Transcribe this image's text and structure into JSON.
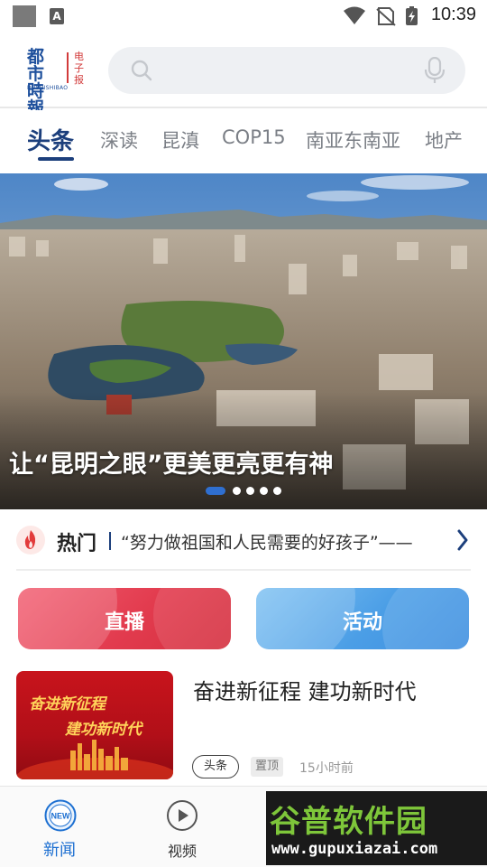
{
  "status_bar": {
    "a_badge": "A",
    "time": "10:39"
  },
  "header": {
    "logo": {
      "main": "都市時報",
      "sub": "DUSHISHIBAO",
      "side": "电子报"
    },
    "search_placeholder": ""
  },
  "tabs": [
    {
      "label": "头条",
      "active": true
    },
    {
      "label": "深读"
    },
    {
      "label": "昆滇"
    },
    {
      "label": "COP15"
    },
    {
      "label": "南亚东南亚"
    },
    {
      "label": "地产"
    }
  ],
  "hero": {
    "caption": "让“昆明之眼”更美更亮更有神",
    "slide_count": 5,
    "active_slide": 1
  },
  "hot": {
    "label": "热门",
    "text": "“努力做祖国和人民需要的好孩子”——"
  },
  "actions": {
    "live": "直播",
    "activity": "活动"
  },
  "news": [
    {
      "thumb_line1": "奋进新征程",
      "thumb_line2": "建功新时代",
      "title": "奋进新征程  建功新时代",
      "tag": "头条",
      "pin": "置顶",
      "time": "15小时前"
    }
  ],
  "bottom_nav": {
    "news_icon_text": "NEW",
    "news": "新闻",
    "video": "视频"
  },
  "watermark": {
    "main": "谷普软件园",
    "sub": "www.gupuxiazai.com"
  },
  "colors": {
    "brand_blue": "#1c3f7c",
    "live_red": "#e23b4e",
    "activity_blue": "#4b9ee6",
    "nav_active": "#1c6fd1"
  }
}
